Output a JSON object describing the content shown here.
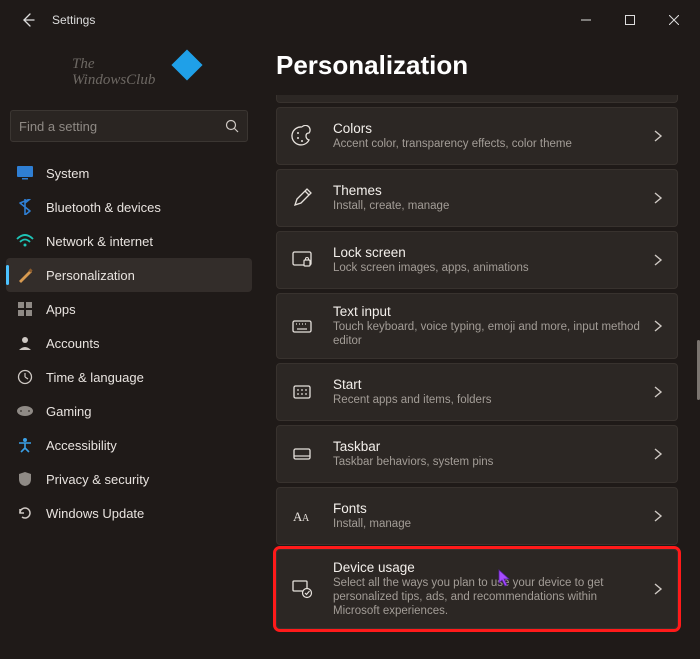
{
  "app": {
    "title": "Settings"
  },
  "logo": {
    "line1": "The",
    "line2": "WindowsClub"
  },
  "search": {
    "placeholder": "Find a setting"
  },
  "nav": {
    "items": [
      {
        "label": "System"
      },
      {
        "label": "Bluetooth & devices"
      },
      {
        "label": "Network & internet"
      },
      {
        "label": "Personalization"
      },
      {
        "label": "Apps"
      },
      {
        "label": "Accounts"
      },
      {
        "label": "Time & language"
      },
      {
        "label": "Gaming"
      },
      {
        "label": "Accessibility"
      },
      {
        "label": "Privacy & security"
      },
      {
        "label": "Windows Update"
      }
    ],
    "selectedIndex": 3
  },
  "page": {
    "title": "Personalization"
  },
  "cards": [
    {
      "title": "Colors",
      "sub": "Accent color, transparency effects, color theme"
    },
    {
      "title": "Themes",
      "sub": "Install, create, manage"
    },
    {
      "title": "Lock screen",
      "sub": "Lock screen images, apps, animations"
    },
    {
      "title": "Text input",
      "sub": "Touch keyboard, voice typing, emoji and more, input method editor"
    },
    {
      "title": "Start",
      "sub": "Recent apps and items, folders"
    },
    {
      "title": "Taskbar",
      "sub": "Taskbar behaviors, system pins"
    },
    {
      "title": "Fonts",
      "sub": "Install, manage"
    },
    {
      "title": "Device usage",
      "sub": "Select all the ways you plan to use your device to get personalized tips, ads, and recommendations within Microsoft experiences."
    }
  ],
  "highlightedCardIndex": 7
}
